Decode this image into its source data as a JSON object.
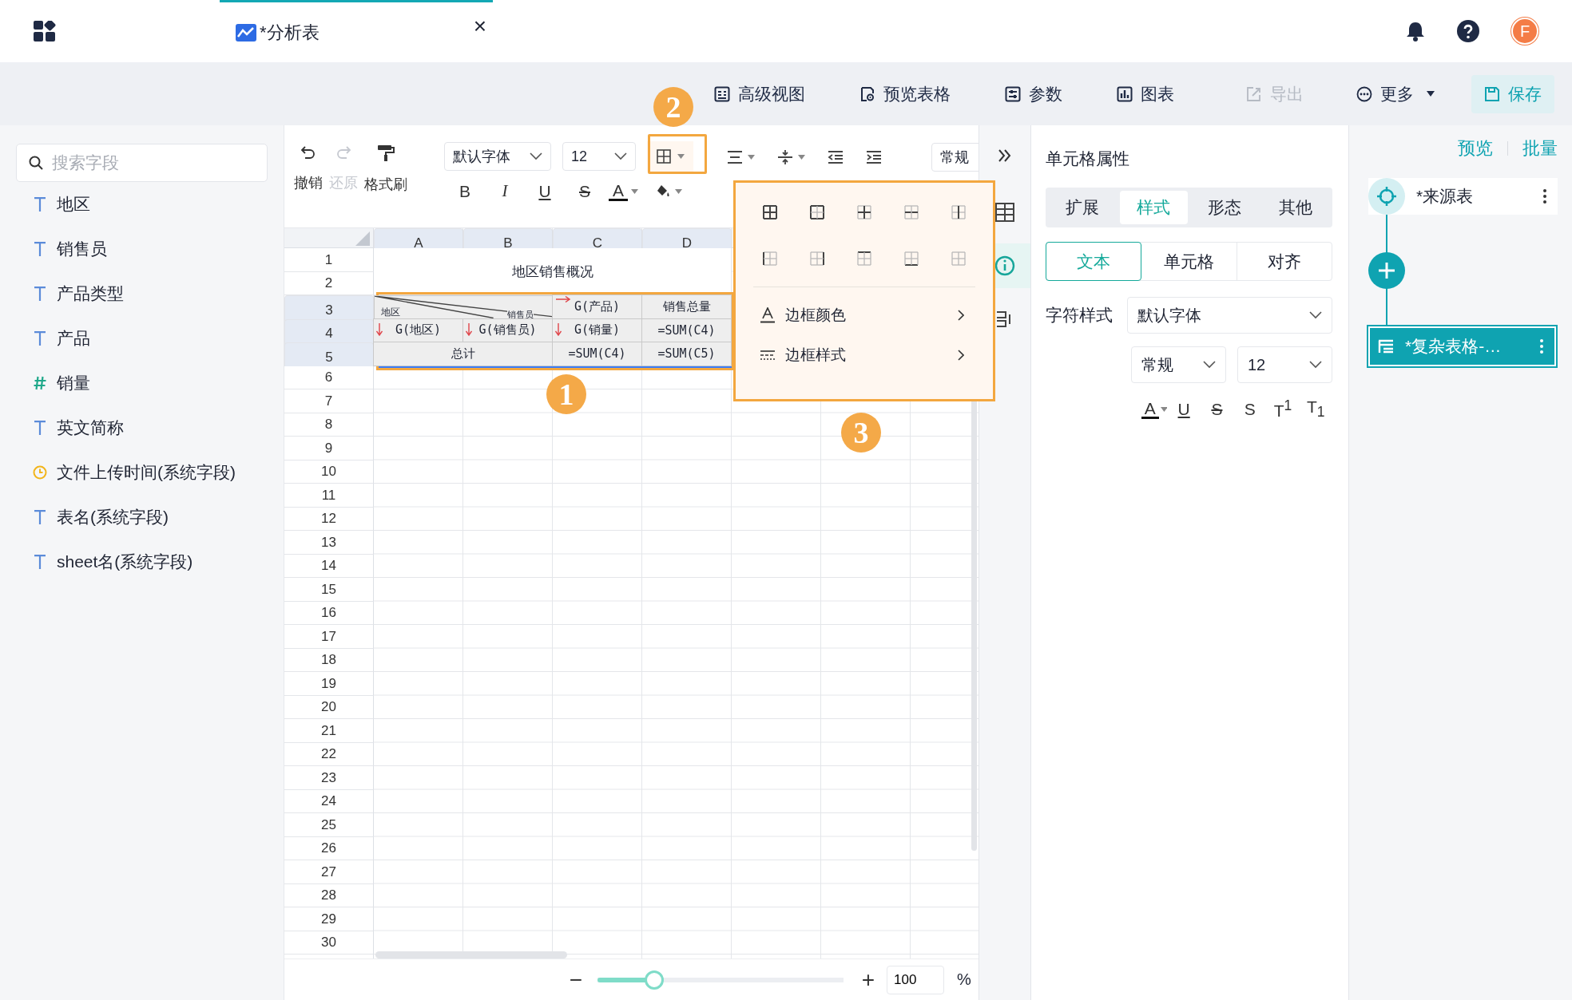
{
  "app_bar": {
    "tab": {
      "title": "*分析表",
      "close": "×"
    },
    "avatar": "F"
  },
  "actions": [
    {
      "label": "高级视图",
      "kind": "view",
      "disabled": false
    },
    {
      "label": "预览表格",
      "kind": "preview",
      "disabled": false
    },
    {
      "label": "参数",
      "kind": "params",
      "disabled": false
    },
    {
      "label": "图表",
      "kind": "chart",
      "disabled": false
    },
    {
      "label": "导出",
      "kind": "export",
      "disabled": true
    },
    {
      "label": "更多",
      "kind": "more",
      "disabled": false
    }
  ],
  "save": {
    "label": "保存"
  },
  "sidebar": {
    "search": {
      "placeholder": "搜索字段"
    },
    "fields": [
      {
        "label": "地区",
        "kind": "text"
      },
      {
        "label": "销售员",
        "kind": "text"
      },
      {
        "label": "产品类型",
        "kind": "text"
      },
      {
        "label": "产品",
        "kind": "text"
      },
      {
        "label": "销量",
        "kind": "number"
      },
      {
        "label": "英文简称",
        "kind": "text"
      },
      {
        "label": "文件上传时间(系统字段)",
        "kind": "time"
      },
      {
        "label": "表名(系统字段)",
        "kind": "text"
      },
      {
        "label": "sheet名(系统字段)",
        "kind": "text"
      }
    ]
  },
  "toolbar": {
    "history": [
      {
        "label": "撤销",
        "kind": "undo",
        "disabled": false
      },
      {
        "label": "还原",
        "kind": "redo",
        "disabled": true
      },
      {
        "label": "格式刷",
        "kind": "brush",
        "disabled": false
      }
    ],
    "font": "默认字体",
    "size": "12",
    "format": [
      "B",
      "I",
      "U",
      "S"
    ],
    "text_color": "A",
    "number_format": "常规"
  },
  "sheet": {
    "columns": [
      {
        "label": "A",
        "selected": true
      },
      {
        "label": "B",
        "selected": true
      },
      {
        "label": "C",
        "selected": true
      },
      {
        "label": "D",
        "selected": true
      }
    ],
    "row_numbers": [
      {
        "label": "1",
        "selected": false
      },
      {
        "label": "2",
        "selected": false
      },
      {
        "label": "3",
        "selected": true
      },
      {
        "label": "4",
        "selected": true
      },
      {
        "label": "5",
        "selected": true
      },
      {
        "label": "6",
        "selected": false
      },
      {
        "label": "7",
        "selected": false
      },
      {
        "label": "8",
        "selected": false
      },
      {
        "label": "9",
        "selected": false
      },
      {
        "label": "10",
        "selected": false
      },
      {
        "label": "11",
        "selected": false
      },
      {
        "label": "12",
        "selected": false
      },
      {
        "label": "13",
        "selected": false
      },
      {
        "label": "14",
        "selected": false
      },
      {
        "label": "15",
        "selected": false
      },
      {
        "label": "16",
        "selected": false
      },
      {
        "label": "17",
        "selected": false
      },
      {
        "label": "18",
        "selected": false
      },
      {
        "label": "19",
        "selected": false
      },
      {
        "label": "20",
        "selected": false
      },
      {
        "label": "21",
        "selected": false
      },
      {
        "label": "22",
        "selected": false
      },
      {
        "label": "23",
        "selected": false
      },
      {
        "label": "24",
        "selected": false
      },
      {
        "label": "25",
        "selected": false
      },
      {
        "label": "26",
        "selected": false
      },
      {
        "label": "27",
        "selected": false
      },
      {
        "label": "28",
        "selected": false
      },
      {
        "label": "29",
        "selected": false
      },
      {
        "label": "30",
        "selected": false
      }
    ],
    "title": "地区销售概况",
    "corner": {
      "bottom_left": "地区",
      "right": "销售员"
    },
    "cells": [
      {
        "text": "G(产品)",
        "kind": "across"
      },
      {
        "text": "销售总量",
        "kind": "plain"
      },
      {
        "text": "G(地区)",
        "kind": "down"
      },
      {
        "text": "G(销售员)",
        "kind": "down"
      },
      {
        "text": "G(销量)",
        "kind": "down"
      },
      {
        "text": "=SUM(C4)",
        "kind": "plain"
      },
      {
        "text": "总计",
        "kind": "plain"
      },
      {
        "text": "=SUM(C4)",
        "kind": "plain"
      },
      {
        "text": "=SUM(C5)",
        "kind": "plain"
      }
    ]
  },
  "zoom": {
    "minus": "−",
    "plus": "+",
    "level": 0.23,
    "value": "100",
    "unit": "%"
  },
  "border_menu": {
    "options": [
      {
        "label": "边框颜色",
        "kind": "color"
      },
      {
        "label": "边框样式",
        "kind": "style"
      }
    ]
  },
  "props": {
    "title": "单元格属性",
    "tabs": [
      {
        "label": "扩展",
        "selected": false
      },
      {
        "label": "样式",
        "selected": true
      },
      {
        "label": "形态",
        "selected": false
      },
      {
        "label": "其他",
        "selected": false
      }
    ],
    "subtabs": [
      {
        "label": "文本",
        "selected": true
      },
      {
        "label": "单元格",
        "selected": false
      },
      {
        "label": "对齐",
        "selected": false
      }
    ],
    "char_style_label": "字符样式",
    "font": "默认字体",
    "weight": "常规",
    "size": "12",
    "text_styles": [
      "A",
      "U",
      "S",
      "S",
      "T$^{1}$",
      "T$_{1}$"
    ]
  },
  "flow": {
    "links": [
      "预览",
      "批量"
    ],
    "nodes": [
      {
        "label": "*来源表",
        "kind": "source",
        "selected": false
      },
      {
        "label": "*复杂表格-…",
        "kind": "table",
        "selected": true
      }
    ]
  },
  "callouts": [
    "1",
    "2",
    "3"
  ]
}
